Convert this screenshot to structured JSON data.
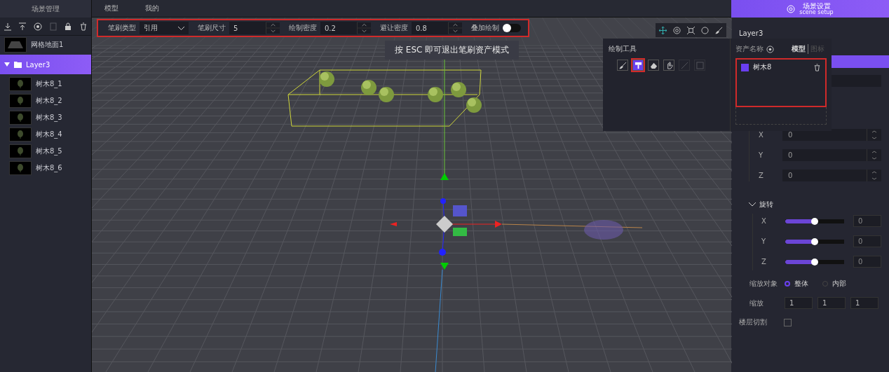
{
  "left_panel": {
    "title": "场景管理",
    "tools": [
      {
        "kind": "download",
        "disabled": false
      },
      {
        "kind": "upload",
        "disabled": false
      },
      {
        "kind": "target",
        "disabled": false
      },
      {
        "kind": "copy",
        "disabled": true
      },
      {
        "kind": "lock",
        "disabled": false
      },
      {
        "kind": "trash",
        "disabled": false
      }
    ],
    "items": [
      {
        "kind": "ground",
        "label": "网格地面1",
        "selected": false
      },
      {
        "kind": "folder",
        "label": "Layer3",
        "selected": true,
        "expanded": true,
        "children": [
          {
            "label": "树木8_1",
            "selected": false
          },
          {
            "label": "树木8_2",
            "selected": false
          },
          {
            "label": "树木8_3",
            "selected": false
          },
          {
            "label": "树木8_4",
            "selected": false
          },
          {
            "label": "树木8_5",
            "selected": false
          },
          {
            "label": "树木8_6",
            "selected": false
          }
        ]
      }
    ]
  },
  "top_tabs": [
    {
      "label": "模型"
    },
    {
      "label": "我的"
    }
  ],
  "brush_toolbar": [
    {
      "kind": "select",
      "label": "笔刷类型",
      "value": "引用"
    },
    {
      "kind": "number",
      "label": "笔刷尺寸",
      "value": "5"
    },
    {
      "kind": "number",
      "label": "绘制密度",
      "value": "0.2"
    },
    {
      "kind": "number",
      "label": "避让密度",
      "value": "0.8"
    },
    {
      "kind": "toggle",
      "label": "叠加绘制",
      "on": false
    }
  ],
  "hint": "按 ESC 即可退出笔刷资产模式",
  "view_tools": [
    {
      "kind": "move",
      "selected": true
    },
    {
      "kind": "rotate",
      "selected": false
    },
    {
      "kind": "scale",
      "selected": false
    },
    {
      "kind": "circle",
      "selected": false
    },
    {
      "kind": "brush",
      "selected": false
    }
  ],
  "brush_popover": {
    "title": "绘制工具",
    "tools": [
      {
        "kind": "brush",
        "selected": false,
        "disabled": false
      },
      {
        "kind": "roller",
        "selected": true,
        "disabled": false
      },
      {
        "kind": "eraser",
        "selected": false,
        "disabled": false
      },
      {
        "kind": "hand",
        "selected": false,
        "disabled": false
      },
      {
        "kind": "line",
        "selected": false,
        "disabled": true
      },
      {
        "kind": "rect",
        "selected": false,
        "disabled": true
      }
    ],
    "asset_header": "资产名称",
    "asset_tabs": [
      {
        "label": "模型",
        "selected": true
      },
      {
        "label": "图标",
        "selected": false
      }
    ],
    "assets": [
      {
        "label": "树木8",
        "checked": true
      }
    ]
  },
  "right_panel": {
    "title": "场景设置",
    "subtitle": "scene setup",
    "layer_name": "Layer3",
    "position": [
      {
        "axis": "X",
        "value": "0"
      },
      {
        "axis": "Y",
        "value": "0"
      },
      {
        "axis": "Z",
        "value": "0"
      }
    ],
    "rotation": {
      "title": "旋转",
      "expanded": true,
      "axes": [
        {
          "axis": "X",
          "level": 0.5,
          "value": "0"
        },
        {
          "axis": "Y",
          "level": 0.5,
          "value": "0"
        },
        {
          "axis": "Z",
          "level": 0.5,
          "value": "0"
        }
      ]
    },
    "scale_target": {
      "label": "缩放对象",
      "options": [
        {
          "label": "整体",
          "selected": true
        },
        {
          "label": "内部",
          "selected": false
        }
      ]
    },
    "scale": {
      "label": "缩放",
      "values": [
        "1",
        "1",
        "1"
      ]
    },
    "floor_cut": {
      "label": "楼层切割",
      "checked": false
    }
  }
}
